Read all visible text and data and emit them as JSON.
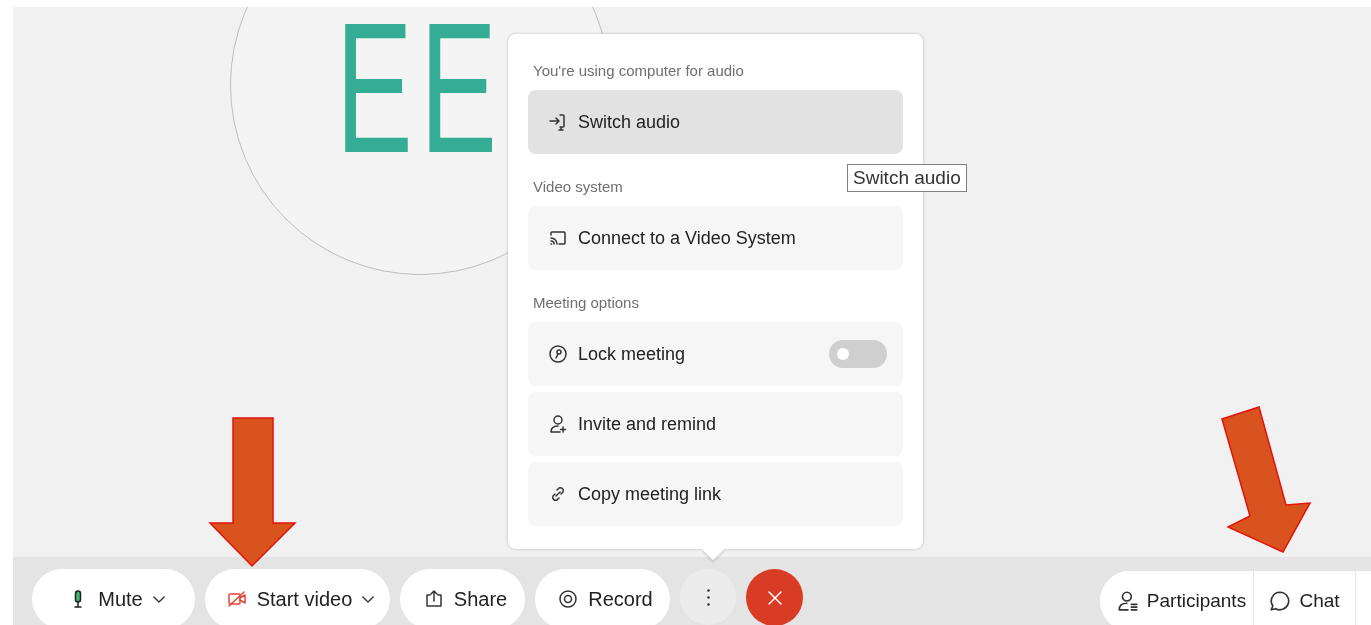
{
  "avatar": {
    "initials": "EE"
  },
  "menu": {
    "sections": [
      {
        "heading": "You're using computer for audio",
        "items": [
          {
            "kind": "action",
            "label": "Switch audio",
            "selected": true
          }
        ]
      },
      {
        "heading": "Video system",
        "items": [
          {
            "kind": "action",
            "label": "Connect to a Video System",
            "selected": false
          }
        ]
      },
      {
        "heading": "Meeting options",
        "items": [
          {
            "kind": "toggle",
            "label": "Lock meeting",
            "selected": false,
            "on": false
          },
          {
            "kind": "action",
            "label": "Invite and remind",
            "selected": false
          },
          {
            "kind": "action",
            "label": "Copy meeting link",
            "selected": false
          }
        ]
      }
    ]
  },
  "tooltip": {
    "text": "Switch audio"
  },
  "toolbar": {
    "left": [
      {
        "kind": "mute",
        "label": "Mute",
        "dropdown": true
      },
      {
        "kind": "video",
        "label": "Start video",
        "dropdown": true
      },
      {
        "kind": "share",
        "label": "Share",
        "dropdown": false
      },
      {
        "kind": "record",
        "label": "Record",
        "dropdown": false
      },
      {
        "kind": "more",
        "expanded": true
      },
      {
        "kind": "end"
      }
    ],
    "right": [
      {
        "kind": "participants",
        "label": "Participants"
      },
      {
        "kind": "chat",
        "label": "Chat"
      }
    ]
  }
}
